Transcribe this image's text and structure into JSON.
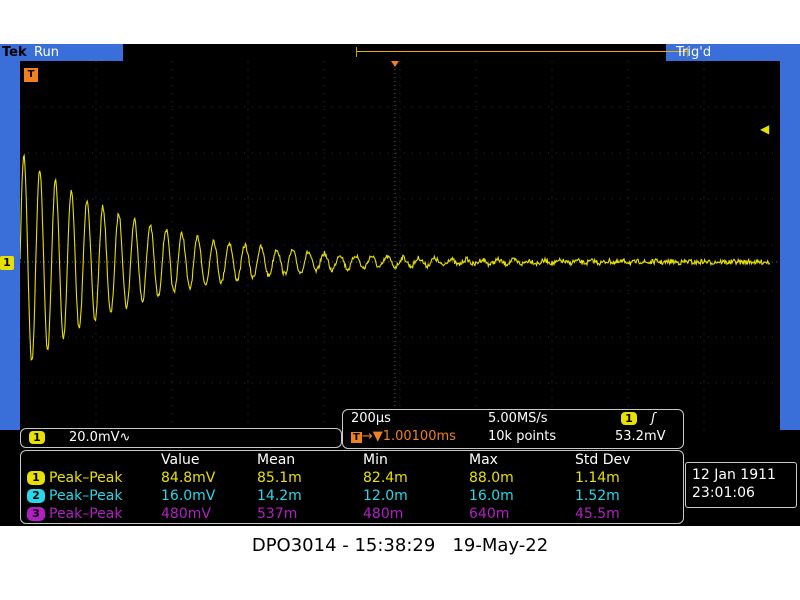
{
  "header": {
    "brand": "Tek",
    "run_state": "Run",
    "trigger_state": "Trig'd"
  },
  "markers": {
    "trigger_position": "T",
    "channel1": "1"
  },
  "vertical": {
    "channel": "1",
    "scale": "20.0mV",
    "coupling_icon": "∿"
  },
  "horizontal": {
    "time_per_div": "200µs",
    "sample_rate": "5.00MS/s",
    "trigger_channel": "1",
    "trigger_slope_icon": "rising-edge-icon",
    "trigger_slope_glyph": "ʃ",
    "delay": "1.00100ms",
    "record_length": "10k points",
    "trigger_level": "53.2mV"
  },
  "measurements": {
    "headers": [
      "Value",
      "Mean",
      "Min",
      "Max",
      "Std Dev"
    ],
    "rows": [
      {
        "channel": "1",
        "name": "Peak–Peak",
        "color": "#e8e000",
        "value": "84.8mV",
        "mean": "85.1m",
        "min": "82.4m",
        "max": "88.0m",
        "std": "1.14m"
      },
      {
        "channel": "2",
        "name": "Peak–Peak",
        "color": "#28d8e8",
        "value": "16.0mV",
        "mean": "14.2m",
        "min": "12.0m",
        "max": "16.0m",
        "std": "1.52m"
      },
      {
        "channel": "3",
        "name": "Peak–Peak",
        "color": "#b020c0",
        "value": "480mV",
        "mean": "537m",
        "min": "480m",
        "max": "640m",
        "std": "45.5m"
      }
    ]
  },
  "datetime": {
    "date": "12 Jan  1911",
    "time": "23:01:06"
  },
  "caption": "DPO3014 - 15:38:29   19-May-22",
  "colors": {
    "ch1": "#e8e000",
    "ch2": "#28d8e8",
    "ch3": "#b020c0",
    "bezel": "#3a6ed8",
    "trigger": "#f08020"
  }
}
